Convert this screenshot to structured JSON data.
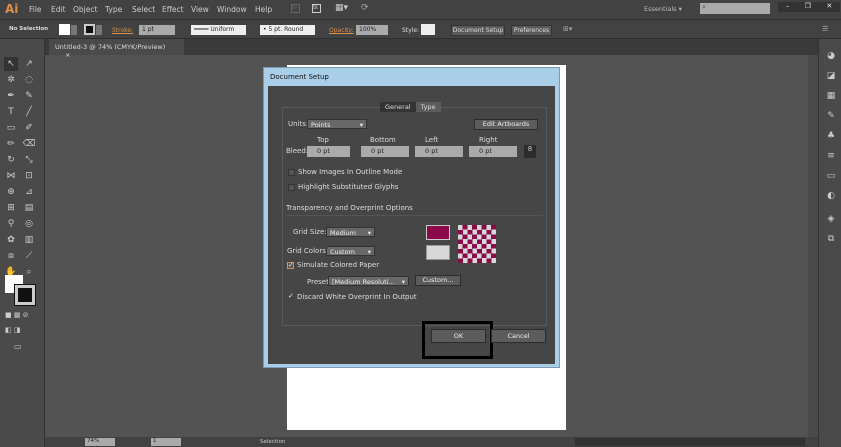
{
  "app": {
    "logo": "Ai",
    "menu": [
      "File",
      "Edit",
      "Object",
      "Type",
      "Select",
      "Effect",
      "View",
      "Window",
      "Help"
    ],
    "workspace": "Essentials",
    "search_placeholder": ""
  },
  "control": {
    "selection": "No Selection",
    "stroke_label": "Stroke:",
    "stroke_value": "1 pt",
    "profile": "Uniform",
    "brush": "5 pt. Round",
    "opacity_label": "Opacity:",
    "opacity_value": "100%",
    "style_label": "Style:",
    "doc_setup": "Document Setup",
    "preferences": "Preferences"
  },
  "doc_tab": {
    "title": "Untitled-3 @ 74% (CMYK/Preview)",
    "close": "×"
  },
  "status": {
    "zoom": "74%",
    "page": "1",
    "tool": "Selection"
  },
  "dialog": {
    "title": "Document Setup",
    "tabs": [
      "General",
      "Type"
    ],
    "active_tab": "General",
    "units_label": "Units:",
    "units_value": "Points",
    "edit_artboards": "Edit Artboards",
    "bleed_label": "Bleed:",
    "bleed": [
      {
        "label": "Top",
        "value": "0 pt"
      },
      {
        "label": "Bottom",
        "value": "0 pt"
      },
      {
        "label": "Left",
        "value": "0 pt"
      },
      {
        "label": "Right",
        "value": "0 pt"
      }
    ],
    "show_images": {
      "label": "Show Images In Outline Mode",
      "checked": false
    },
    "highlight_glyphs": {
      "label": "Highlight Substituted Glyphs",
      "checked": false
    },
    "section": "Transparency and Overprint Options",
    "grid_size_label": "Grid Size:",
    "grid_size_value": "Medium",
    "grid_colors_label": "Grid Colors:",
    "grid_colors_value": "Custom",
    "grid_color_1": "#8a0a4a",
    "grid_color_2": "#d8d8d8",
    "simulate_paper": {
      "label": "Simulate Colored Paper",
      "checked": true
    },
    "preset_label": "Preset:",
    "preset_value": "[Medium Resoluti...",
    "custom_button": "Custom...",
    "discard_white": {
      "label": "Discard White Overprint In Output",
      "checked": true
    },
    "ok": "OK",
    "cancel": "Cancel"
  }
}
